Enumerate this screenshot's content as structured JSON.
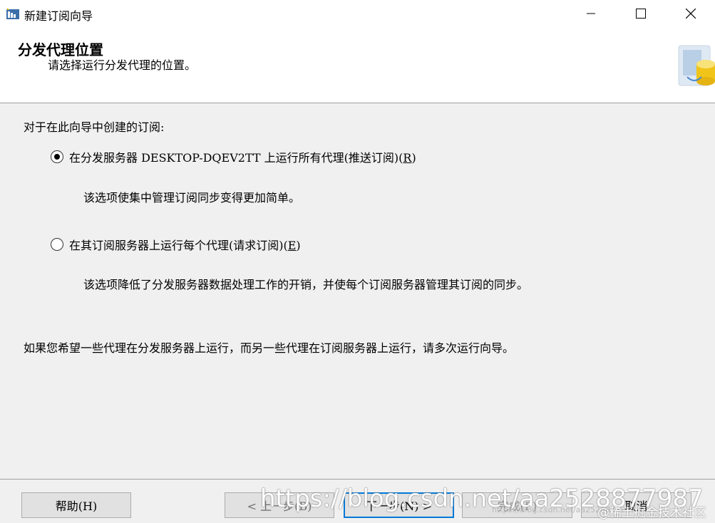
{
  "window": {
    "title": "新建订阅向导",
    "icon": "wizard-app-icon"
  },
  "header": {
    "title": "分发代理位置",
    "subtitle": "请选择运行分发代理的位置。"
  },
  "content": {
    "prompt": "对于在此向导中创建的订阅:",
    "option_push": {
      "label": "在分发服务器 DESKTOP-DQEV2TT 上运行所有代理(推送订阅)(",
      "accel": "R",
      "close": ")",
      "selected": true,
      "description": "该选项使集中管理订阅同步变得更加简单。"
    },
    "option_pull": {
      "label": "在其订阅服务器上运行每个代理(请求订阅)(",
      "accel": "E",
      "close": ")",
      "selected": false,
      "description": "该选项降低了分发服务器数据处理工作的开销，并使每个订阅服务器管理其订阅的同步。"
    },
    "note": "如果您希望一些代理在分发服务器上运行，而另一些代理在订阅服务器上运行，请多次运行向导。"
  },
  "buttons": {
    "help": "帮助(H)",
    "back": "< 上一步(B)",
    "next": "下一步(N) >",
    "finish": "完成(F)",
    "cancel": "取消"
  },
  "watermark": {
    "url": "https://blog.csdn.net/aa2528877987",
    "small": "https://blog.csdn.net/aa2528877987",
    "site": "@稀土掘金技术社区"
  },
  "colors": {
    "accent": "#0078d7",
    "background": "#f0f0f0"
  }
}
